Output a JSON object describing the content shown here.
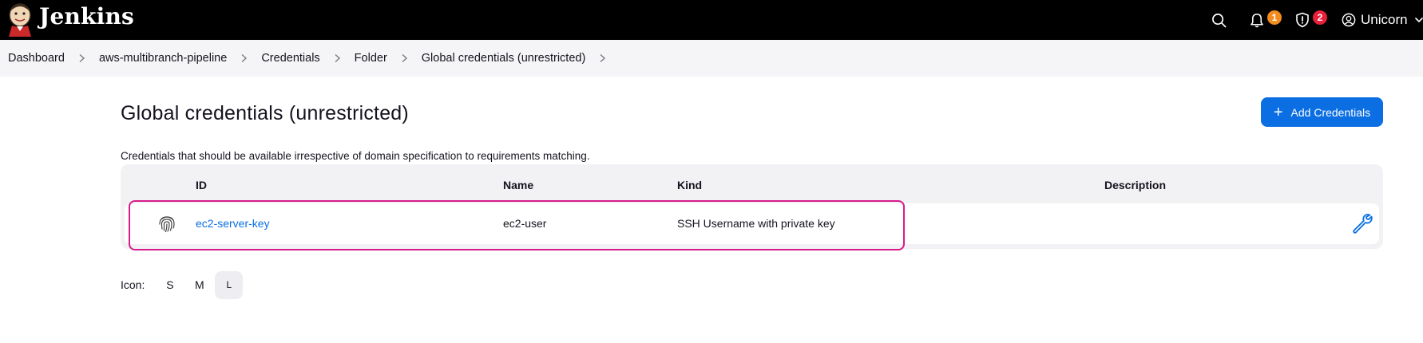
{
  "app": {
    "title": "Jenkins"
  },
  "header": {
    "notifications_count": "1",
    "security_count": "2",
    "user_name": "Unicorn",
    "icons": [
      "search-icon",
      "bell-icon",
      "shield-icon",
      "user-icon",
      "chevron-down-icon"
    ]
  },
  "breadcrumb": {
    "items": [
      "Dashboard",
      "aws-multibranch-pipeline",
      "Credentials",
      "Folder",
      "Global credentials (unrestricted)"
    ]
  },
  "main": {
    "title": "Global credentials (unrestricted)",
    "add_button_label": "Add Credentials",
    "description": "Credentials that should be available irrespective of domain specification to requirements matching."
  },
  "table": {
    "columns": [
      "ID",
      "Name",
      "Kind",
      "Description"
    ],
    "rows": [
      {
        "id": "ec2-server-key",
        "name": "ec2-user",
        "kind": "SSH Username with private key",
        "description": ""
      }
    ]
  },
  "icon_size": {
    "label": "Icon:",
    "options": [
      "S",
      "M",
      "L"
    ],
    "selected": "L"
  },
  "colors": {
    "header_bg": "#000000",
    "accent": "#0b6fe3",
    "highlight": "#d81b8a",
    "badge_orange": "#f28c1f",
    "badge_red": "#e8213b"
  }
}
